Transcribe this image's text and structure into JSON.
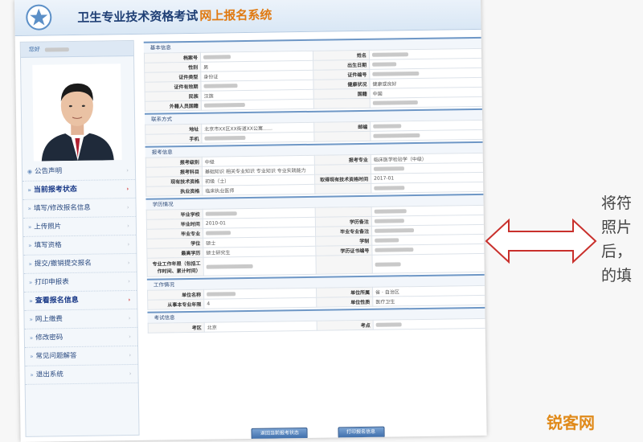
{
  "header": {
    "title_main": "卫生专业技术资格考试",
    "title_sub": "网上报名系统"
  },
  "sidebar": {
    "welcome": "您好",
    "items": [
      {
        "label": "公告声明",
        "icon": "megaphone-icon"
      },
      {
        "label": "当前报考状态",
        "icon": "bullet-icon"
      },
      {
        "label": "填写/修改报名信息",
        "icon": "bullet-icon"
      },
      {
        "label": "上传照片",
        "icon": "bullet-icon"
      },
      {
        "label": "填写资格",
        "icon": "bullet-icon"
      },
      {
        "label": "提交/撤销提交报名",
        "icon": "bullet-icon"
      },
      {
        "label": "打印申报表",
        "icon": "bullet-icon"
      },
      {
        "label": "查看报名信息",
        "icon": "bullet-icon"
      },
      {
        "label": "网上缴费",
        "icon": "bullet-icon"
      },
      {
        "label": "修改密码",
        "icon": "bullet-icon"
      },
      {
        "label": "常见问题解答",
        "icon": "bullet-icon"
      },
      {
        "label": "退出系统",
        "icon": "bullet-icon"
      }
    ]
  },
  "sections": {
    "basic": {
      "title": "基本信息",
      "rows": [
        {
          "l1": "档案号",
          "v1": "",
          "l2": "姓名",
          "v2": ""
        },
        {
          "l1": "性别",
          "v1": "男",
          "l2": "出生日期",
          "v2": ""
        },
        {
          "l1": "证件类型",
          "v1": "身份证",
          "l2": "证件编号",
          "v2": ""
        },
        {
          "l1": "证件有效期",
          "v1": "",
          "l2": "健康状况",
          "v2": "健康或良好"
        },
        {
          "l1": "民族",
          "v1": "汉族",
          "l2": "国籍",
          "v2": "中国"
        },
        {
          "l1": "外籍人员国籍",
          "v1": "",
          "l2": "",
          "v2": ""
        }
      ]
    },
    "contact": {
      "title": "联系方式",
      "rows": [
        {
          "l1": "地址",
          "v1": "北京市XX区XX街道XX公寓……",
          "l2": "邮编",
          "v2": ""
        },
        {
          "l1": "手机",
          "v1": "",
          "l2": "",
          "v2": ""
        }
      ]
    },
    "exam": {
      "title": "报考信息",
      "rows": [
        {
          "l1": "报考级别",
          "v1": "中级",
          "l2": "报考专业",
          "v2": "临床医学检验学（中级）"
        },
        {
          "l1": "报考科目",
          "v1": "基础知识  相关专业知识  专业知识  专业实践能力",
          "l2": "",
          "v2": ""
        },
        {
          "l1": "现有技术资格",
          "v1": "初级（士）",
          "l2": "取得现有技术资格时间",
          "v2": "2017-01"
        },
        {
          "l1": "执业资格",
          "v1": "临床执业医师",
          "l2": "",
          "v2": ""
        }
      ]
    },
    "edu": {
      "title": "学历情况",
      "rows": [
        {
          "l1": "毕业学校",
          "v1": "",
          "l2": "",
          "v2": ""
        },
        {
          "l1": "毕业时间",
          "v1": "2010-01",
          "l2": "学历备注",
          "v2": ""
        },
        {
          "l1": "毕业专业",
          "v1": "",
          "l2": "毕业专业备注",
          "v2": ""
        },
        {
          "l1": "学位",
          "v1": "硕士",
          "l2": "学制",
          "v2": ""
        },
        {
          "l1": "最高学历",
          "v1": "硕士研究生",
          "l2": "学历证书编号",
          "v2": ""
        },
        {
          "l1": "专业工作年限（包括工作时间、累计时间）",
          "v1": "",
          "l2": "",
          "v2": ""
        }
      ]
    },
    "work": {
      "title": "工作情况",
      "rows": [
        {
          "l1": "单位名称",
          "v1": "",
          "l2": "单位所属",
          "v2": "省 · 自治区"
        },
        {
          "l1": "从事本专业年限",
          "v1": "4",
          "l2": "单位性质",
          "v2": "医疗卫生"
        }
      ]
    },
    "venue": {
      "title": "考试信息",
      "rows": [
        {
          "l1": "考区",
          "v1": "北京",
          "l2": "考点",
          "v2": ""
        }
      ]
    }
  },
  "buttons": {
    "back": "返回当前报考状态",
    "print": "打印报名信息"
  },
  "annotation": {
    "lines": [
      "将符",
      "照片",
      "后，",
      "的填"
    ]
  },
  "watermark": "锐客网"
}
